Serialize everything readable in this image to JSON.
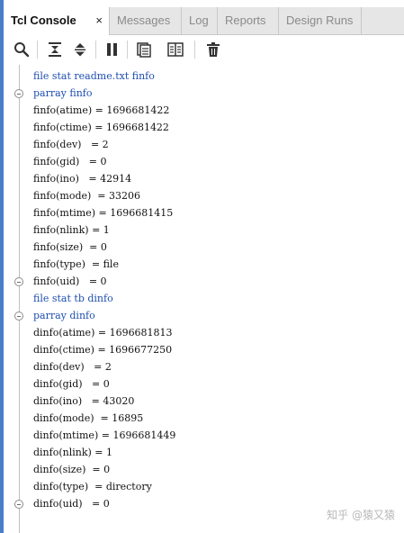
{
  "tabs": [
    {
      "label": "Tcl Console",
      "active": true,
      "close": "×"
    },
    {
      "label": "Messages"
    },
    {
      "label": "Log"
    },
    {
      "label": "Reports"
    },
    {
      "label": "Design Runs"
    }
  ],
  "toolbar": {
    "icons": [
      "search-icon",
      "collapse-all-icon",
      "expand-all-icon",
      "pause-icon",
      "copy-icon",
      "columns-icon",
      "delete-icon"
    ]
  },
  "console": {
    "lines": [
      {
        "text": "file stat readme.txt finfo",
        "type": "cmd"
      },
      {
        "text": "parray finfo",
        "type": "cmd"
      },
      {
        "text": "finfo(atime) = 1696681422",
        "type": "out"
      },
      {
        "text": "finfo(ctime) = 1696681422",
        "type": "out"
      },
      {
        "text": "finfo(dev)   = 2",
        "type": "out"
      },
      {
        "text": "finfo(gid)   = 0",
        "type": "out"
      },
      {
        "text": "finfo(ino)   = 42914",
        "type": "out"
      },
      {
        "text": "finfo(mode)  = 33206",
        "type": "out"
      },
      {
        "text": "finfo(mtime) = 1696681415",
        "type": "out"
      },
      {
        "text": "finfo(nlink) = 1",
        "type": "out"
      },
      {
        "text": "finfo(size)  = 0",
        "type": "out"
      },
      {
        "text": "finfo(type)  = file",
        "type": "out"
      },
      {
        "text": "finfo(uid)   = 0",
        "type": "out"
      },
      {
        "text": "file stat tb dinfo",
        "type": "cmd"
      },
      {
        "text": "parray dinfo",
        "type": "cmd"
      },
      {
        "text": "dinfo(atime) = 1696681813",
        "type": "out"
      },
      {
        "text": "dinfo(ctime) = 1696677250",
        "type": "out"
      },
      {
        "text": "dinfo(dev)   = 2",
        "type": "out"
      },
      {
        "text": "dinfo(gid)   = 0",
        "type": "out"
      },
      {
        "text": "dinfo(ino)   = 43020",
        "type": "out"
      },
      {
        "text": "dinfo(mode)  = 16895",
        "type": "out"
      },
      {
        "text": "dinfo(mtime) = 1696681449",
        "type": "out"
      },
      {
        "text": "dinfo(nlink) = 1",
        "type": "out"
      },
      {
        "text": "dinfo(size)  = 0",
        "type": "out"
      },
      {
        "text": "dinfo(type)  = directory",
        "type": "out"
      },
      {
        "text": "dinfo(uid)   = 0",
        "type": "out"
      }
    ]
  },
  "watermark": "知乎 @猿又猿",
  "colors": {
    "accent": "#4a7ec9",
    "command": "#1f4fb0",
    "tab_bg": "#e6e6e6"
  }
}
